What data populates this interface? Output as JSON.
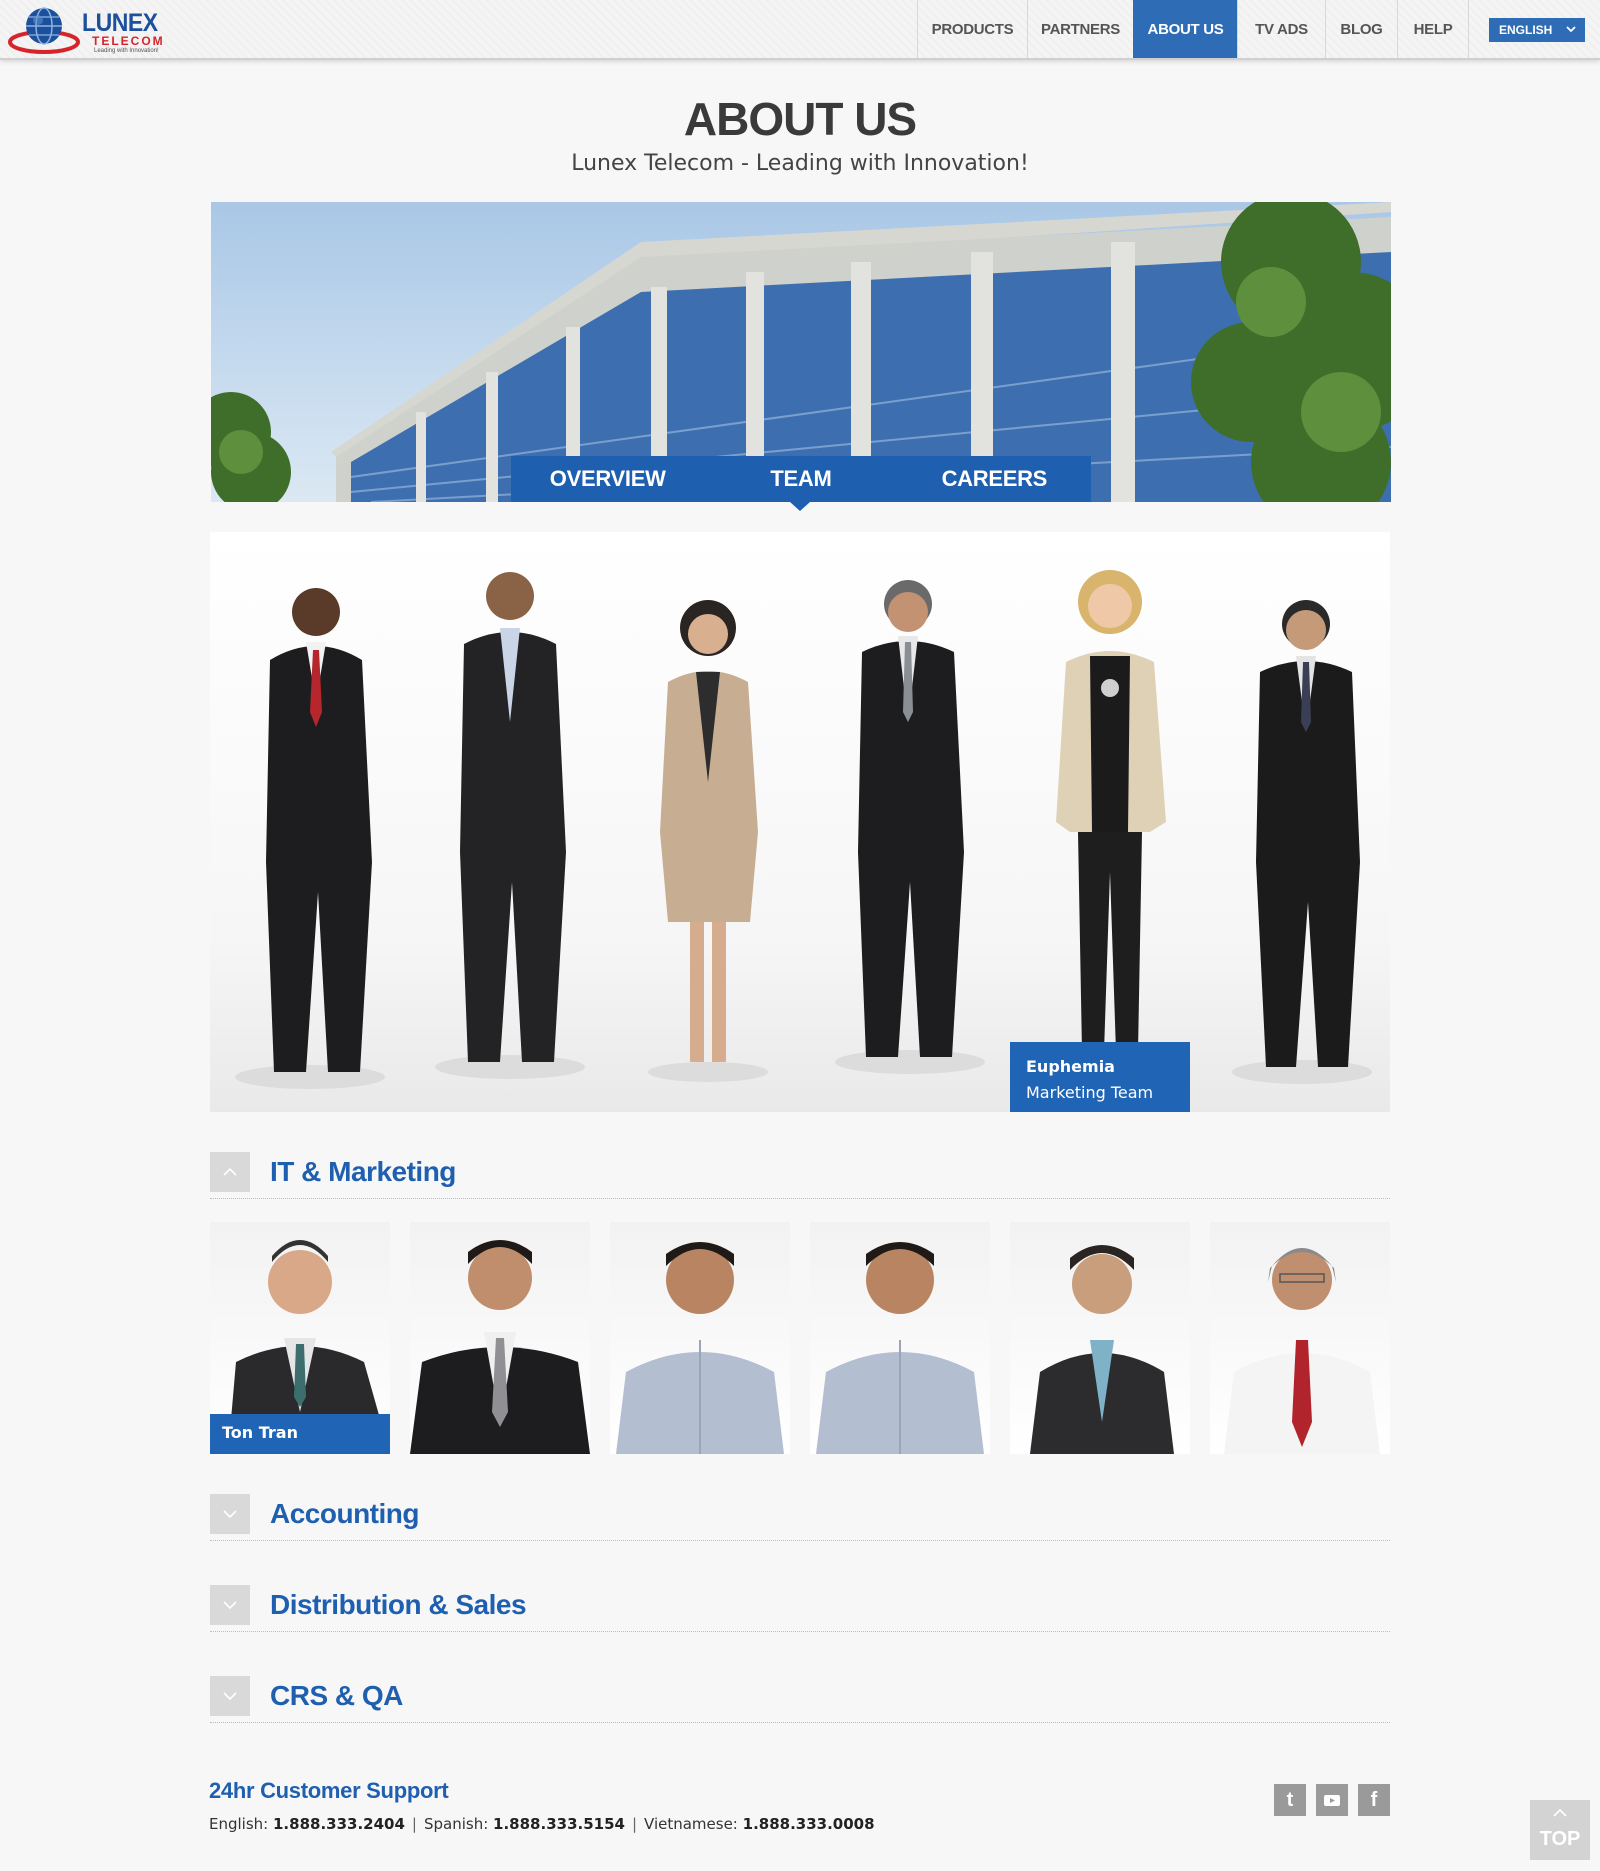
{
  "brand": {
    "name": "LUNEX",
    "sub": "TELECOM",
    "tagline": "Leading with Innovation!"
  },
  "nav": {
    "items": [
      {
        "label": "PRODUCTS",
        "active": false
      },
      {
        "label": "PARTNERS",
        "active": false
      },
      {
        "label": "ABOUT US",
        "active": true
      },
      {
        "label": "TV ADS",
        "active": false
      },
      {
        "label": "BLOG",
        "active": false
      },
      {
        "label": "HELP",
        "active": false
      }
    ],
    "language": "ENGLISH"
  },
  "page": {
    "title": "ABOUT US",
    "subtitle": "Lunex Telecom - Leading with Innovation!"
  },
  "tabs": [
    {
      "label": "OVERVIEW",
      "active": false
    },
    {
      "label": "TEAM",
      "active": true
    },
    {
      "label": "CAREERS",
      "active": false
    }
  ],
  "featured": {
    "name": "Euphemia",
    "role": "Marketing Team"
  },
  "sections": [
    {
      "title": "IT & Marketing",
      "expanded": true
    },
    {
      "title": "Accounting",
      "expanded": false
    },
    {
      "title": "Distribution & Sales",
      "expanded": false
    },
    {
      "title": "CRS & QA",
      "expanded": false
    }
  ],
  "it_members": {
    "hover_label": "Ton Tran"
  },
  "footer": {
    "support_title": "24hr Customer Support",
    "english_label": "English:",
    "english_phone": "1.888.333.2404",
    "spanish_label": "Spanish:",
    "spanish_phone": "1.888.333.5154",
    "vietnamese_label": "Vietnamese:",
    "vietnamese_phone": "1.888.333.0008",
    "separator": "|",
    "top_label": "TOP"
  },
  "colors": {
    "accent": "#2e6cb5",
    "tab_bar": "#1f5fb0",
    "brand_red": "#d6242b"
  },
  "icons": {
    "social": [
      "twitter-icon",
      "youtube-icon",
      "facebook-icon"
    ]
  }
}
